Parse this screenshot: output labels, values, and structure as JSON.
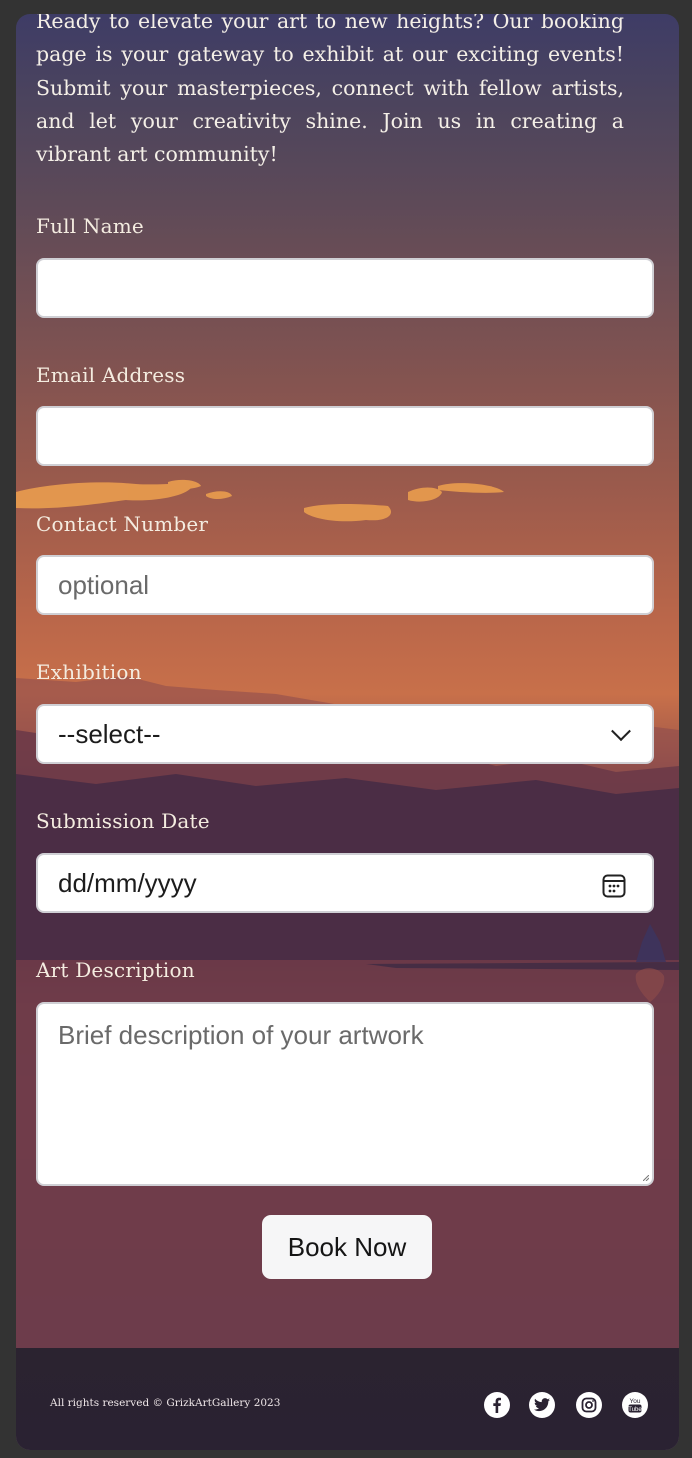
{
  "intro": {
    "text": "Ready to elevate your art to new heights? Our booking page is your gateway to exhibit at our exciting events! Submit your masterpieces, connect with fellow artists, and let your creativity shine. Join us in creating a vibrant art community!"
  },
  "form": {
    "full_name": {
      "label": "Full Name",
      "value": ""
    },
    "email": {
      "label": "Email Address",
      "value": ""
    },
    "contact": {
      "label": "Contact Number",
      "placeholder": "optional"
    },
    "exhibition": {
      "label": "Exhibition",
      "selected": "--select--"
    },
    "submission_date": {
      "label": "Submission Date",
      "value": "dd/mm/yyyy"
    },
    "description": {
      "label": "Art Description",
      "placeholder": "Brief description of your artwork"
    },
    "submit_label": "Book Now"
  },
  "footer": {
    "copyright": "All rights reserved © GrizkArtGallery 2023",
    "social": [
      "facebook-icon",
      "twitter-icon",
      "instagram-icon",
      "youtube-icon"
    ]
  },
  "colors": {
    "footer_bg": "#2b2330",
    "label_text": "#f4ece0",
    "field_bg": "#ffffff",
    "button_bg": "#f6f6f7"
  }
}
